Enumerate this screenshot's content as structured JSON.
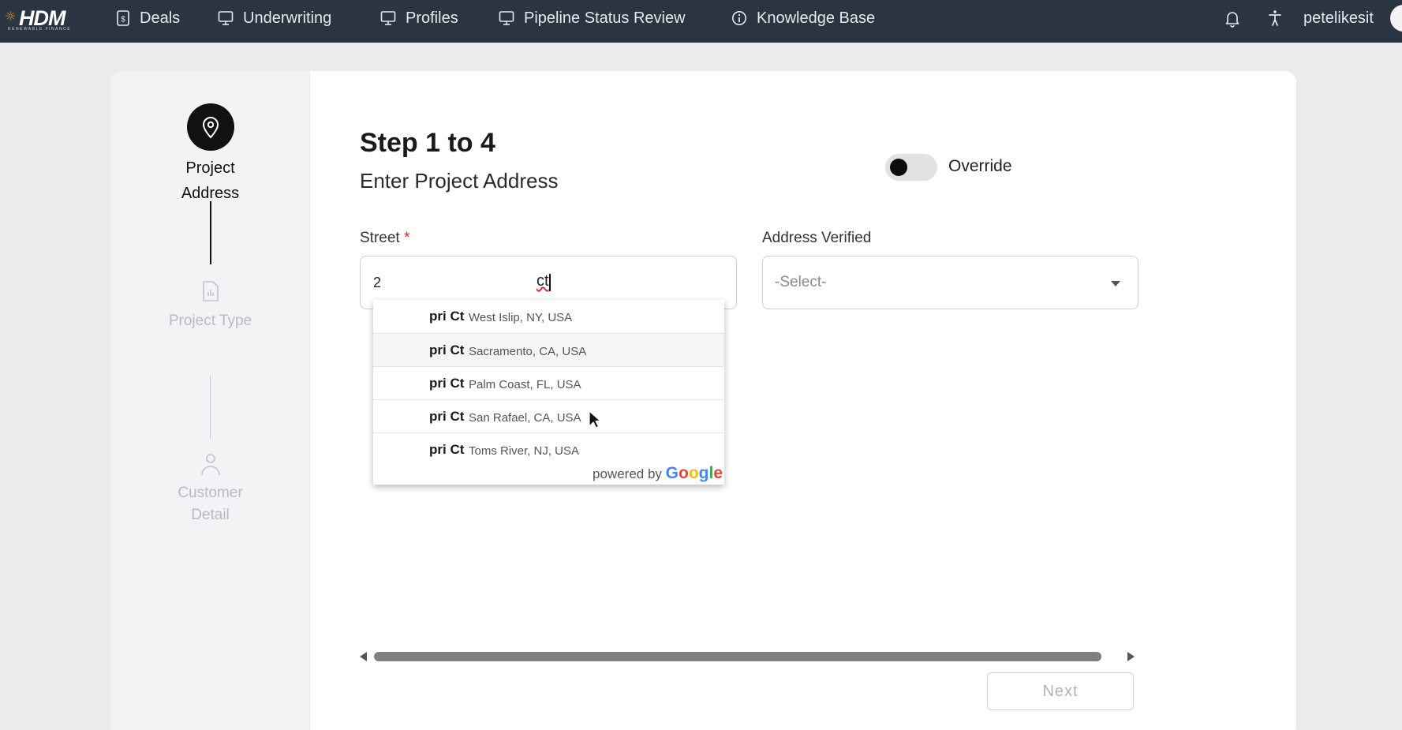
{
  "topnav": {
    "logo": {
      "text": "HDM",
      "subtext": "RENEWABLE FINANCE",
      "icon": "sun-logo-icon"
    },
    "items": [
      {
        "label": "Deals",
        "icon": "dollar-icon"
      },
      {
        "label": "Underwriting",
        "icon": "monitor-icon"
      },
      {
        "label": "Profiles",
        "icon": "monitor-icon"
      },
      {
        "label": "Pipeline Status Review",
        "icon": "monitor-icon"
      },
      {
        "label": "Knowledge Base",
        "icon": "info-icon"
      }
    ],
    "notification_icon": "bell-icon",
    "accessibility_icon": "accessibility-icon",
    "username": "petelikesit"
  },
  "stepper": {
    "steps": [
      {
        "label_line1": "Project",
        "label_line2": "Address",
        "icon": "map-pin-icon",
        "state": "active"
      },
      {
        "label_line1": "Project Type",
        "icon": "document-chart-icon",
        "state": "inactive"
      },
      {
        "label_line1": "Customer",
        "label_line2": "Detail",
        "icon": "person-icon",
        "state": "inactive"
      }
    ]
  },
  "form": {
    "title": "Step 1 to 4",
    "subtitle": "Enter Project Address",
    "override_label": "Override",
    "override_on": false,
    "street_label": "Street",
    "street_value_visible_start": "2",
    "street_value_visible_end": "ct",
    "address_verified_label": "Address Verified",
    "address_verified_placeholder": "-Select-",
    "next_label": "Next"
  },
  "autocomplete": {
    "suggestions": [
      {
        "main": "pri Ct",
        "secondary": "West Islip, NY, USA"
      },
      {
        "main": "pri Ct",
        "secondary": "Sacramento, CA, USA"
      },
      {
        "main": "pri Ct",
        "secondary": "Palm Coast, FL, USA"
      },
      {
        "main": "pri Ct",
        "secondary": "San Rafael, CA, USA"
      },
      {
        "main": "pri Ct",
        "secondary": "Toms River, NJ, USA"
      }
    ],
    "hovered_index": 1,
    "powered_by": "powered by",
    "google": "Google"
  },
  "colors": {
    "nav_bg": "#2b3441",
    "accent_dark": "#111111",
    "required": "#d32f2f"
  }
}
